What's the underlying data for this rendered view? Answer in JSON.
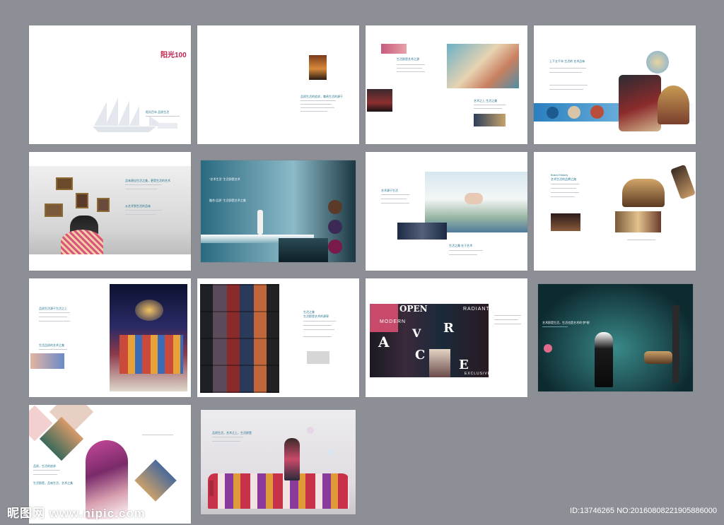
{
  "brochure": {
    "logo_text": "阳光100",
    "cover_slogan": "阳光百年 品质生活",
    "p2_caption": "品质生活的追求，尊贵生活的源于",
    "p3_caption_1": "生活即是艺术之源",
    "p3_caption_2": "艺术之上 生活之美",
    "p4_caption": "上下五千年 生活的 艺术品味",
    "p5_caption_1": "品味源自生活之美，更是生活的艺术",
    "p5_caption_2": "从艺术到生活的品味",
    "p6_caption_1": "“艺术生活”  生活即是艺术",
    "p6_caption_2": "融合“品质”  生活即是艺术之美",
    "p7_caption_1": "艺术源于生活",
    "p7_caption_2": "生活之美 在于艺术",
    "p8_caption_1": "Brand History",
    "p8_caption_2": "艺术生活的品牌之路",
    "p9_caption_1": "品质生活源于生活之上",
    "p9_caption_2": "生活品质的艺术之美",
    "p10_caption_1": "生活之美",
    "p10_caption_2": "生活即是艺术的源泉",
    "p11_words": [
      "OPEN",
      "MODERN",
      "RADIANT",
      "R",
      "V",
      "A",
      "C",
      "E",
      "EXCLUSIVE"
    ],
    "p12_caption": "艺术即是生活，生活也是艺术的“梦”想",
    "p13_caption_1": "品质，生活的追求",
    "p13_caption_2": "生活即是，品味生活，艺术之美",
    "p14_caption": "品质生活，艺术之上，生活即是"
  },
  "watermark": {
    "site": "昵图网 www.nipic.com",
    "id_text": "ID:13746265 NO:20160808221905886000"
  },
  "colors": {
    "background": "#8c8f96",
    "accent": "#1d6f8a",
    "logo": "#c21f4a"
  }
}
